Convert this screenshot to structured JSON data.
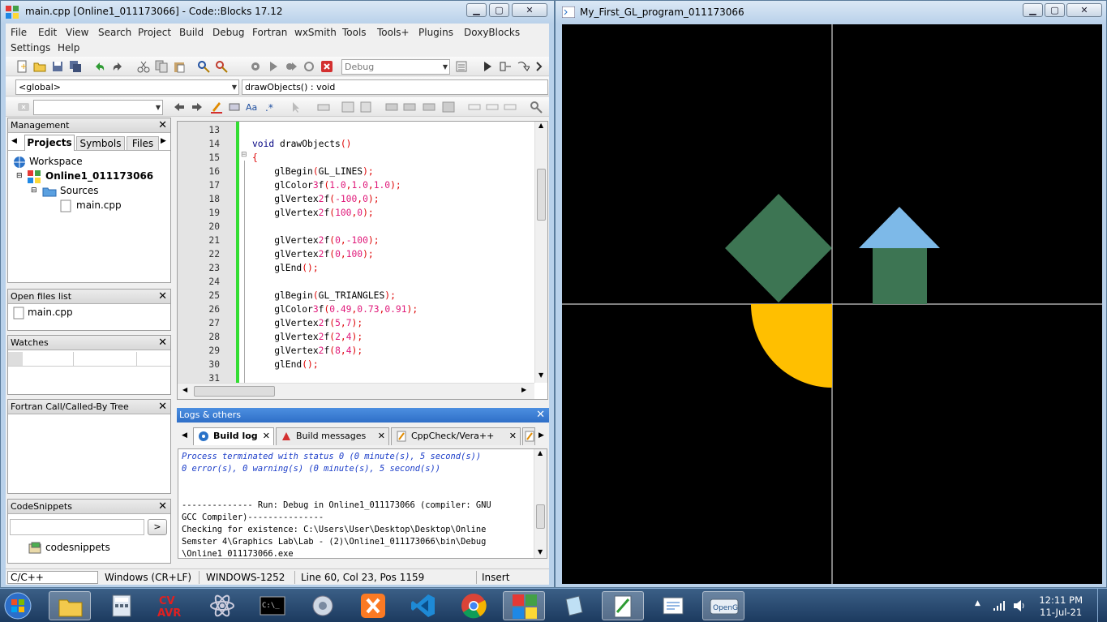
{
  "codeblocks": {
    "title": "main.cpp [Online1_011173066] - Code::Blocks 17.12",
    "menu_row1": [
      "File",
      "Edit",
      "View",
      "Search",
      "Project",
      "Build",
      "Debug",
      "Fortran",
      "wxSmith",
      "Tools",
      "Tools+",
      "Plugins",
      "DoxyBlocks"
    ],
    "menu_row2": [
      "Settings",
      "Help"
    ],
    "build_target": "Debug",
    "scope": "<global>",
    "function": "drawObjects() : void",
    "management": {
      "title": "Management",
      "tabs": [
        "Projects",
        "Symbols",
        "Files"
      ],
      "tree": {
        "workspace": "Workspace",
        "project": "Online1_011173066",
        "folder": "Sources",
        "file": "main.cpp"
      }
    },
    "open_files": {
      "title": "Open files list",
      "items": [
        "main.cpp"
      ]
    },
    "watches": {
      "title": "Watches"
    },
    "fortran_tree": {
      "title": "Fortran Call/Called-By Tree"
    },
    "codesnippets": {
      "title": "CodeSnippets",
      "search_button": ">",
      "item": "codesnippets"
    },
    "editor": {
      "lines": [
        {
          "n": "13",
          "code": ""
        },
        {
          "n": "14",
          "code": "void drawObjects()"
        },
        {
          "n": "15",
          "code": "{"
        },
        {
          "n": "16",
          "code": "    glBegin(GL_LINES);"
        },
        {
          "n": "17",
          "code": "    glColor3f(1.0,1.0,1.0);"
        },
        {
          "n": "18",
          "code": "    glVertex2f(-100,0);"
        },
        {
          "n": "19",
          "code": "    glVertex2f(100,0);"
        },
        {
          "n": "20",
          "code": ""
        },
        {
          "n": "21",
          "code": "    glVertex2f(0,-100);"
        },
        {
          "n": "22",
          "code": "    glVertex2f(0,100);"
        },
        {
          "n": "23",
          "code": "    glEnd();"
        },
        {
          "n": "24",
          "code": ""
        },
        {
          "n": "25",
          "code": "    glBegin(GL_TRIANGLES);"
        },
        {
          "n": "26",
          "code": "    glColor3f(0.49,0.73,0.91);"
        },
        {
          "n": "27",
          "code": "    glVertex2f(5,7);"
        },
        {
          "n": "28",
          "code": "    glVertex2f(2,4);"
        },
        {
          "n": "29",
          "code": "    glVertex2f(8,4);"
        },
        {
          "n": "30",
          "code": "    glEnd();"
        },
        {
          "n": "31",
          "code": ""
        }
      ]
    },
    "logs": {
      "title": "Logs & others",
      "tabs": [
        "Build log",
        "Build messages",
        "CppCheck/Vera++"
      ],
      "lines": [
        {
          "text": "Process terminated with status 0 (0 minute(s), 5 second(s))",
          "style": "blue"
        },
        {
          "text": "0 error(s), 0 warning(s) (0 minute(s), 5 second(s))",
          "style": "blue"
        },
        {
          "text": "",
          "style": ""
        },
        {
          "text": "",
          "style": ""
        },
        {
          "text": "-------------- Run: Debug in Online1_011173066 (compiler: GNU",
          "style": ""
        },
        {
          "text": "GCC Compiler)---------------",
          "style": ""
        },
        {
          "text": "Checking for existence: C:\\Users\\User\\Desktop\\Desktop\\Online",
          "style": ""
        },
        {
          "text": "Semster 4\\Graphics Lab\\Lab - (2)\\Online1_011173066\\bin\\Debug",
          "style": ""
        },
        {
          "text": "\\Online1_011173066.exe",
          "style": ""
        }
      ]
    },
    "status": {
      "language": "C/C++",
      "eol": "Windows (CR+LF)",
      "encoding": "WINDOWS-1252",
      "position": "Line 60, Col 23, Pos 1159",
      "mode": "Insert"
    }
  },
  "gl_window": {
    "title": "My_First_GL_program_011173066",
    "colors": {
      "diamond": "#3d7553",
      "roof": "#7db9e8",
      "house_body": "#3d7553",
      "quarter_circle": "#ffbf00",
      "axes": "#ffffff"
    }
  },
  "taskbar": {
    "time": "12:11 PM",
    "date": "11-Jul-21",
    "apps": [
      "start-orb",
      "file-explorer",
      "calculator",
      "cvavr",
      "atom",
      "command-prompt",
      "settings",
      "xampp",
      "vscode",
      "chrome",
      "codeblocks",
      "notepad",
      "paint-doc",
      "word-doc",
      "opengl"
    ]
  }
}
